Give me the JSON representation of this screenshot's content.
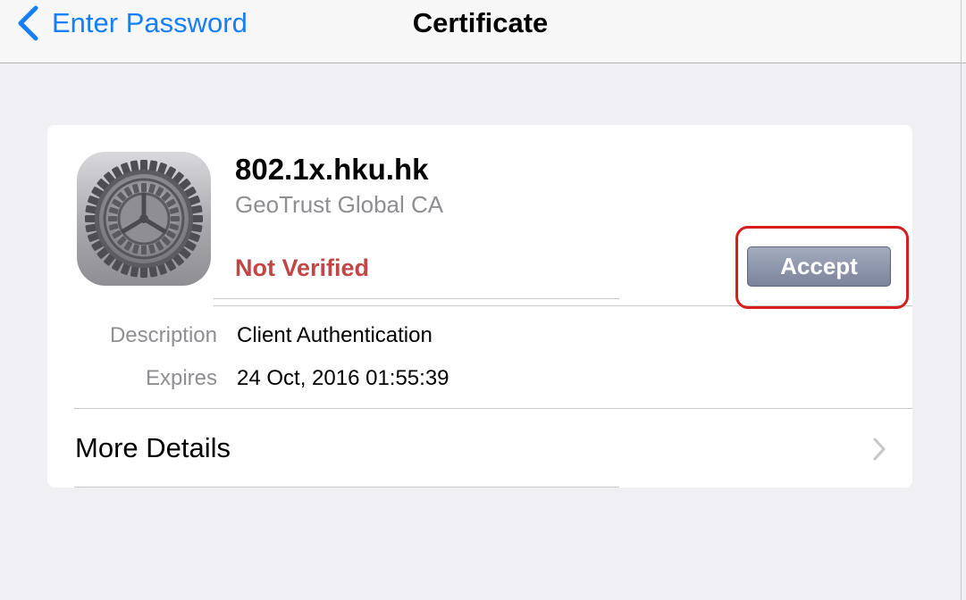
{
  "nav": {
    "back_label": "Enter Password",
    "title": "Certificate"
  },
  "certificate": {
    "name": "802.1x.hku.hk",
    "issuer": "GeoTrust Global CA",
    "status": "Not Verified",
    "accept_label": "Accept",
    "details": [
      {
        "label": "Description",
        "value": "Client Authentication"
      },
      {
        "label": "Expires",
        "value": "24 Oct, 2016 01:55:39"
      }
    ],
    "more_label": "More Details"
  },
  "icons": {
    "back": "chevron-left-icon",
    "app": "settings-gear-icon",
    "more": "chevron-right-icon"
  },
  "colors": {
    "accent": "#157efb",
    "status_error": "#c24646",
    "highlight": "#d91c1c"
  }
}
